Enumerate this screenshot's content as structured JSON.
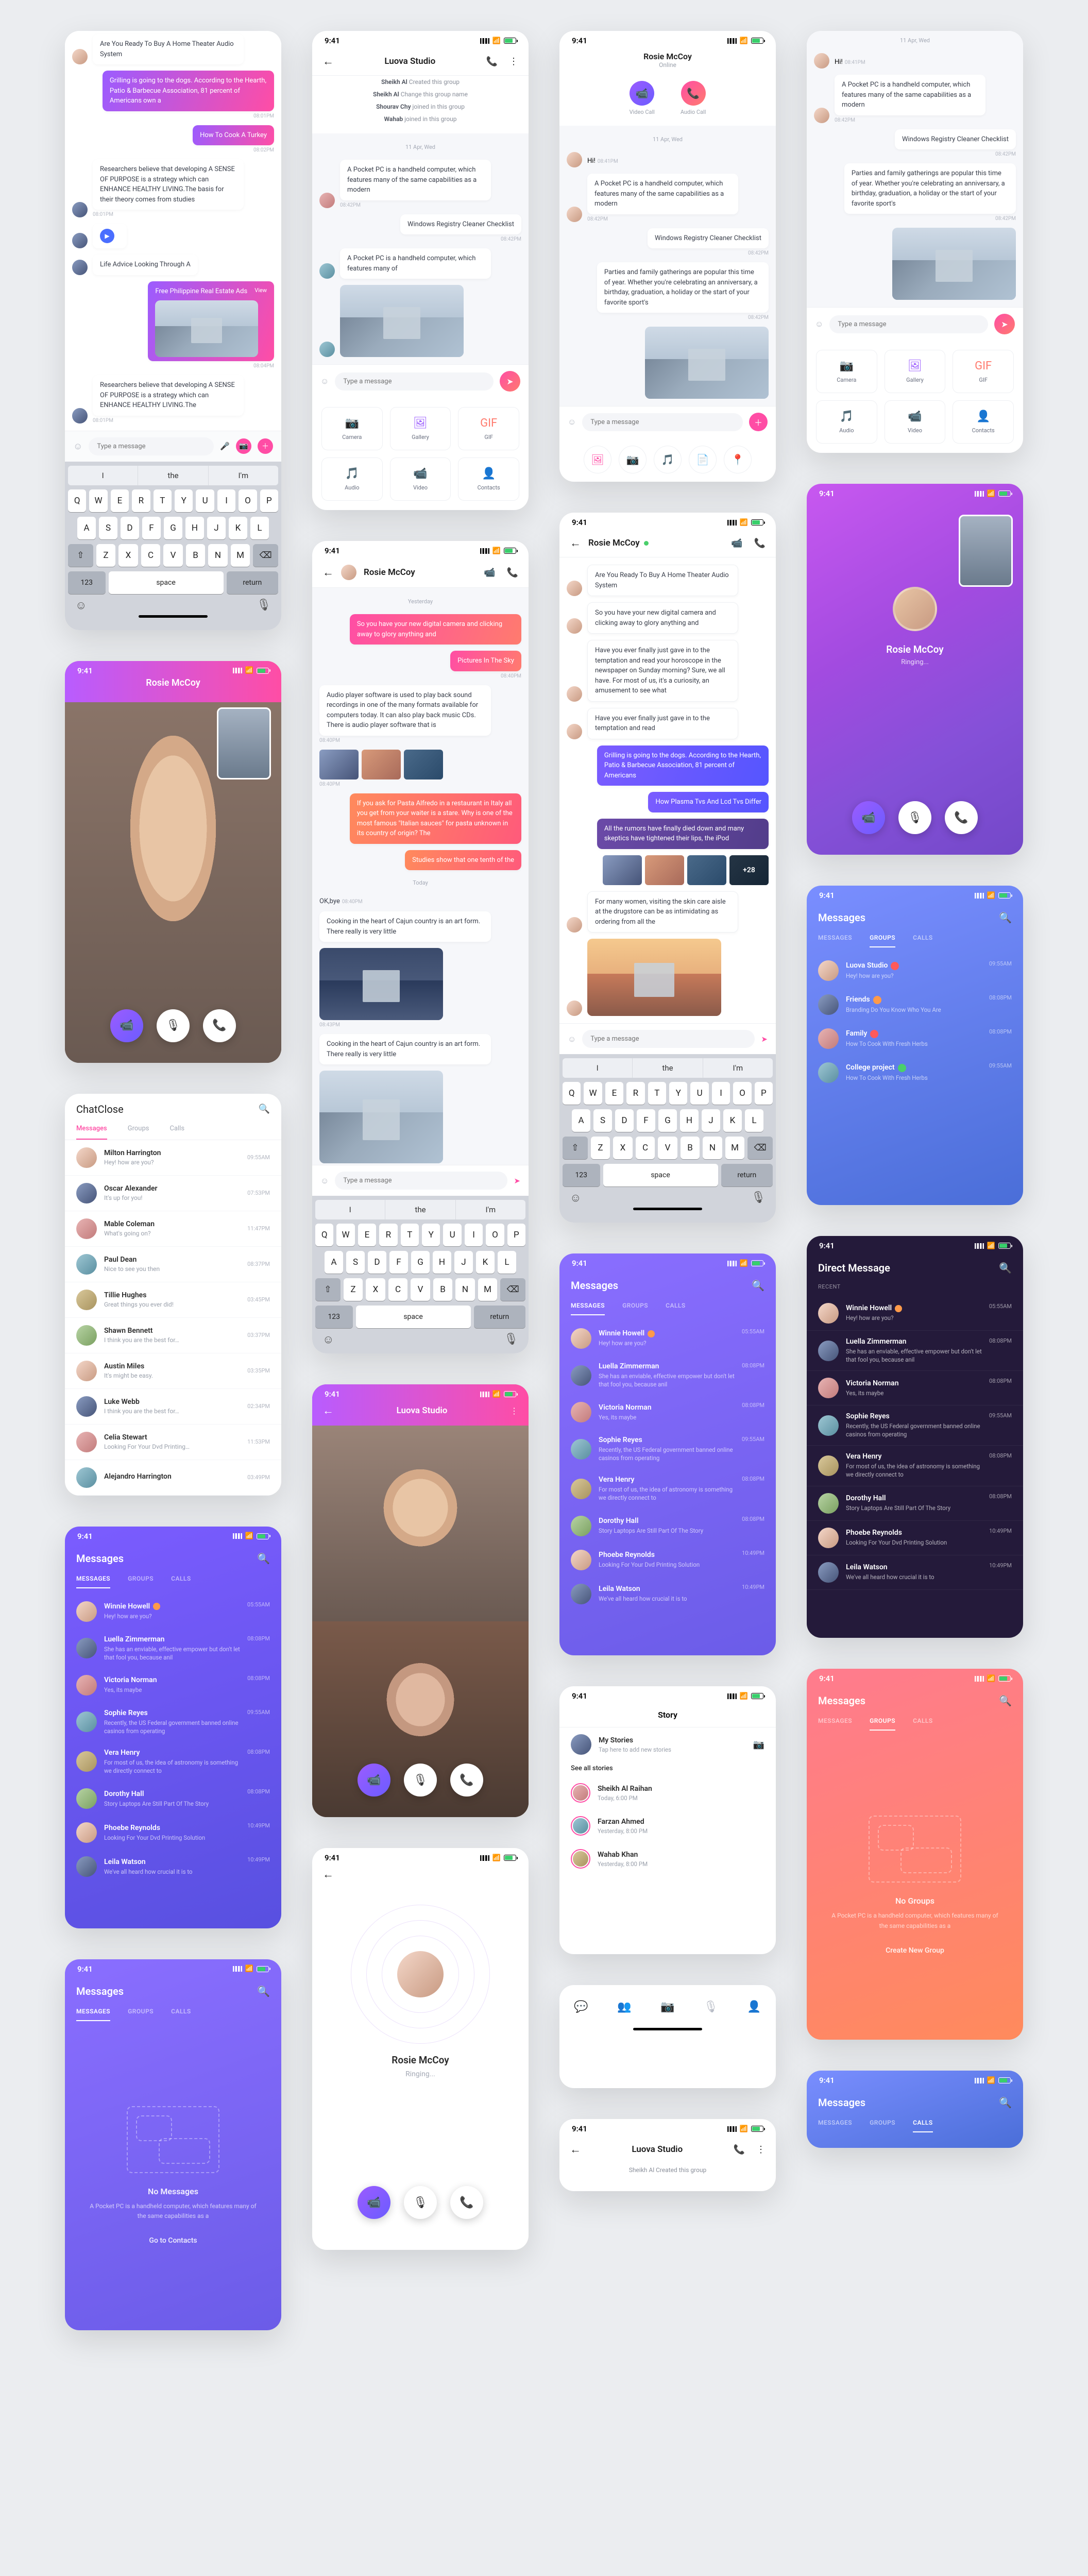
{
  "status": {
    "time": "9:41"
  },
  "chat1": {
    "q": "Are You Ready To Buy A Home Theater Audio System",
    "m1": "Grilling is going to the dogs. According to the Hearth, Patio & Barbecue Association, 81 percent of Americans own a",
    "m2": "How To Cook A Turkey",
    "m3": "Researchers believe that developing A SENSE OF PURPOSE is a strategy which can ENHANCE HEALTHY LIVING.The basis for their theory comes from studies",
    "m4": "Life Advice Looking Through A",
    "m5": "Free Philippine Real Estate Ads",
    "m6": "Researchers believe that developing A SENSE OF PURPOSE is a strategy which can ENHANCE HEALTHY LIVING.The",
    "view": "View",
    "t1": "08:01PM",
    "t2": "08:02PM",
    "t3": "08:01PM",
    "t4": "08:04PM",
    "t5": "08:01PM",
    "input": "Type a message",
    "kbd": {
      "s1": "I",
      "s2": "the",
      "s3": "I'm",
      "space": "space",
      "return": "return",
      "n123": "123"
    }
  },
  "groupchat": {
    "title": "Luova Studio",
    "ev1a": "Sheikh Al",
    "ev1b": "Created this group",
    "ev2a": "Sheikh Al",
    "ev2b": "Change this group name",
    "ev3a": "Shourav Chy",
    "ev3b": "joined in this group",
    "ev4a": "Wahab",
    "ev4b": "joined in this group",
    "date": "11 Apr, Wed",
    "m1": "A Pocket PC is a handheld computer, which features many of the same capabilities as a modern",
    "m2": "Windows Registry Cleaner Checklist",
    "m3": "A Pocket PC is a handheld computer, which features many of",
    "t1": "08:42PM",
    "t2": "08:42PM",
    "input": "Type a message",
    "att": {
      "camera": "Camera",
      "gallery": "Gallery",
      "gif": "GIF",
      "audio": "Audio",
      "video": "Video",
      "contacts": "Contacts"
    }
  },
  "rosie_full": {
    "name": "Rosie McCoy",
    "sub": "Online",
    "video": "Video Call",
    "audio": "Audio Call",
    "date": "11 Apr, Wed",
    "hi": "Hi!",
    "hi_t": "08:41PM",
    "m1": "A Pocket PC is a handheld computer, which features many of the same capabilities as a modern",
    "t1": "08:42PM",
    "m2": "Windows Registry Cleaner Checklist",
    "t2": "08:42PM",
    "m3": "Parties and family gatherings are popular this time of year. Whether you're celebrating an anniversary, a birthday, graduation, a holiday or the start of your favorite sport's",
    "t3": "08:42PM",
    "input": "Type a message"
  },
  "rosie_chat": {
    "name": "Rosie McCoy",
    "yest": "Yesterday",
    "m1": "So you have your new digital camera and clicking away to glory anything and",
    "m2": "Pictures In The Sky",
    "m3": "Audio player software is used to play back sound recordings in one of the many formats available for computers today. It can also play back music CDs. There is audio player software that is",
    "m4": "If you ask for Pasta Alfredo in a restaurant in Italy all you get from your waiter is a stare. Why is one of the most famous \"Italian sauces\" for pasta unknown in its country of origin? The",
    "m5": "Studies show that one tenth of the",
    "today": "Today",
    "ok": "OK,bye",
    "okt": "08:40PM",
    "cook": "Cooking in the heart of Cajun country is an art form. There really is very little",
    "t1": "08:43PM",
    "t2": "08:40PM",
    "t3": "08:40PM",
    "t4": "08:40PM",
    "t5": "08:45PM",
    "input": "Type a message"
  },
  "rosie_thread": {
    "name": "Rosie McCoy",
    "q": "Are You Ready To Buy A Home Theater Audio System",
    "m1": "So you have your new digital camera and clicking away to glory anything and",
    "m2": "Have you ever finally just gave in to the temptation and read your horoscope in the newspaper on Sunday morning? Sure, we all have. For most of us, it's a curiosity, an amusement to see what",
    "m3": "Have you ever finally just gave in to the temptation and read",
    "m4": "Grilling is going to the dogs. According to the Hearth, Patio & Barbecue Association, 81 percent of Americans",
    "m5": "How Plasma Tvs And Lcd Tvs Differ",
    "m6": "All the rumors have finally died down and many skeptics have tightened their lips, the iPod",
    "more": "+28",
    "m7": "For many women, visiting the skin care aisle at the drugstore can be as intimidating as ordering from all the",
    "input": "Type a message"
  },
  "vc_rosie": {
    "name": "Rosie McCoy"
  },
  "vc_out": {
    "name": "Rosie McCoy",
    "status": "Ringing..."
  },
  "vc_luova": {
    "name": "Luova Studio"
  },
  "cc": {
    "title": "ChatClose",
    "tabs": {
      "m": "Messages",
      "g": "Groups",
      "c": "Calls"
    },
    "rows": [
      {
        "n": "Milton Harrington",
        "s": "Hey! how are you?",
        "t": "09:55AM"
      },
      {
        "n": "Oscar Alexander",
        "s": "It's up for you!",
        "t": "07:53PM"
      },
      {
        "n": "Mable Coleman",
        "s": "What's going on?",
        "t": "11:47PM"
      },
      {
        "n": "Paul Dean",
        "s": "Nice to see you then",
        "t": "08:37PM"
      },
      {
        "n": "Tillie Hughes",
        "s": "Great things you ever did!",
        "t": "03:45PM"
      },
      {
        "n": "Shawn Bennett",
        "s": "I think you are the best for…",
        "t": "03:37PM"
      },
      {
        "n": "Austin Miles",
        "s": "It's might be easy.",
        "t": "03:35PM"
      },
      {
        "n": "Luke Webb",
        "s": "I think you are the best for…",
        "t": "02:34PM"
      },
      {
        "n": "Celia Stewart",
        "s": "Looking For Your Dvd Printing…",
        "t": "11:53PM"
      },
      {
        "n": "Alejandro Harrington",
        "s": "",
        "t": "03:49PM"
      }
    ]
  },
  "ml_purple": {
    "title": "Messages",
    "tabs": {
      "m": "MESSAGES",
      "g": "GROUPS",
      "c": "CALLS"
    },
    "rows": [
      {
        "n": "Winnie Howell",
        "s": "Hey! how are you?",
        "t": "05:55AM"
      },
      {
        "n": "Luella Zimmerman",
        "s": "She has an enviable, effective empower but don't let that fool you, because anil",
        "t": "08:08PM"
      },
      {
        "n": "Victoria Norman",
        "s": "Yes, its maybe",
        "t": "08:08PM"
      },
      {
        "n": "Sophie Reyes",
        "s": "Recently, the US Federal government banned online casinos from operating",
        "t": "09:55AM"
      },
      {
        "n": "Vera Henry",
        "s": "For most of us, the idea of astronomy is something we directly connect to",
        "t": "08:08PM"
      },
      {
        "n": "Dorothy Hall",
        "s": "Story Laptops Are Still Part Of The Story",
        "t": "08:08PM"
      },
      {
        "n": "Phoebe Reynolds",
        "s": "Looking For Your Dvd Printing Solution",
        "t": "10:49PM"
      },
      {
        "n": "Leila Watson",
        "s": "We've all heard how crucial it is to",
        "t": "10:49PM"
      }
    ]
  },
  "ml_groups": {
    "title": "Messages",
    "rows": [
      {
        "n": "Luova Studio",
        "s": "Hey! how are you?",
        "t": "09:55AM",
        "b": "red"
      },
      {
        "n": "Friends",
        "s": "Branding Do You Know Who You Are",
        "t": "08:08PM",
        "b": "orange"
      },
      {
        "n": "Family",
        "s": "How To Cook With Fresh Herbs",
        "t": "08:08PM",
        "b": "red"
      },
      {
        "n": "College project",
        "s": "How To Cook With Fresh Herbs",
        "t": "09:55AM",
        "b": "green"
      }
    ]
  },
  "dm": {
    "title": "Direct Message",
    "recent": "RECENT",
    "rows": [
      {
        "n": "Winnie Howell",
        "s": "Hey! how are you?",
        "t": "05:55AM"
      },
      {
        "n": "Luella Zimmerman",
        "s": "She has an enviable, effective empower but don't let that fool you, because anil",
        "t": "08:08PM"
      },
      {
        "n": "Victoria Norman",
        "s": "Yes, its maybe",
        "t": "08:08PM"
      },
      {
        "n": "Sophie Reyes",
        "s": "Recently, the US Federal government banned online casinos from operating",
        "t": "09:55AM"
      },
      {
        "n": "Vera Henry",
        "s": "For most of us, the idea of astronomy is something we directly connect to",
        "t": "08:08PM"
      },
      {
        "n": "Dorothy Hall",
        "s": "Story Laptops Are Still Part Of The Story",
        "t": "08:08PM"
      },
      {
        "n": "Phoebe Reynolds",
        "s": "Looking For Your Dvd Printing Solution",
        "t": "10:49PM"
      },
      {
        "n": "Leila Watson",
        "s": "We've all heard how crucial it is to",
        "t": "10:49PM"
      }
    ]
  },
  "empty_msg": {
    "title": "Messages",
    "h": "No Messages",
    "p": "A Pocket PC is a handheld computer, which features many of the same capabilities as a",
    "cta": "Go to Contacts"
  },
  "empty_grp": {
    "title": "Messages",
    "h": "No Groups",
    "p": "A Pocket PC is a handheld computer, which features many of the same capabilities as a",
    "cta": "Create New Group"
  },
  "story": {
    "title": "Story",
    "my": "My Stories",
    "mysub": "Tap here to add new stories",
    "all": "See all stories",
    "rows": [
      {
        "n": "Sheikh Al Raihan",
        "t": "Today, 6:00 PM"
      },
      {
        "n": "Farzan Ahmed",
        "t": "Yesterday, 8:00 PM"
      },
      {
        "n": "Wahab Khan",
        "t": "Yesterday, 8:00 PM"
      }
    ]
  },
  "luova_bottom": {
    "title": "Luova Studio",
    "ev": "Sheikh Al Created this group"
  },
  "bottom_tabs_blank": {
    "title": "Messages"
  }
}
